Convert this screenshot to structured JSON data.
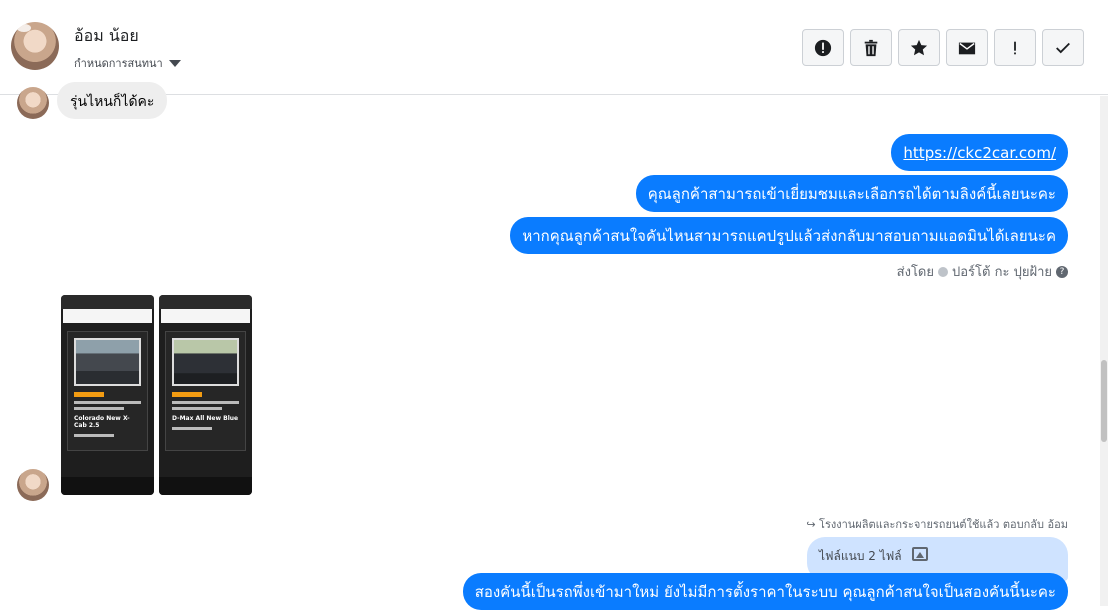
{
  "header": {
    "name": "อ้อม น้อย",
    "conversation_setting": "กำหนดการสนทนา"
  },
  "toolbar": {
    "buttons": [
      {
        "name": "spam-button",
        "icon": "alert-icon"
      },
      {
        "name": "delete-button",
        "icon": "trash-icon"
      },
      {
        "name": "star-button",
        "icon": "star-icon"
      },
      {
        "name": "mark-unread-button",
        "icon": "envelope-icon"
      },
      {
        "name": "follow-up-button",
        "icon": "exclamation-icon"
      },
      {
        "name": "done-button",
        "icon": "check-icon"
      }
    ]
  },
  "messages": {
    "incoming_text": "รุ่นไหนก็ได้คะ",
    "outgoing": [
      "https://ckc2car.com/",
      "คุณลูกค้าสามารถเข้าเยี่ยมชมและเลือกรถได้ตามลิงค์นี้เลยนะคะ",
      "หากคุณลูกค้าสนใจคันไหนสามารถแคปรูปแล้วส่งกลับมาสอบถามแอดมินได้เลยนะค"
    ],
    "sent_by_label": "ส่งโดย",
    "sent_by_name": "ปอร์โต้ กะ ปุยฝ้าย",
    "screenshots": [
      {
        "title": "Colorado New X-Cab 2.5"
      },
      {
        "title": "D-Max All New Blue"
      }
    ],
    "reply_meta": "โรงงานผลิตและกระจายรถยนต์ใช้แล้ว ตอบกลับ อ้อม",
    "attachment_label": "ไฟล์แนบ 2 ไฟล์",
    "final_message": "สองคันนี้เป็นรถพึ่งเข้ามาใหม่ ยังไม่มีการตั้งราคาในระบบ คุณลูกค้าสนใจเป็นสองคันนี้นะคะ"
  }
}
